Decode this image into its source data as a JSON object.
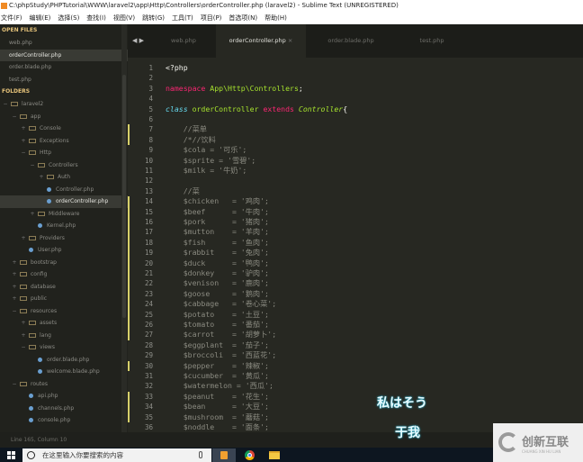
{
  "window": {
    "title": "C:\\phpStudy\\PHPTutorial\\WWW\\laravel2\\app\\Http\\Controllers\\orderController.php (laravel2) - Sublime Text (UNREGISTERED)"
  },
  "menu": [
    "文件(F)",
    "编辑(E)",
    "选择(S)",
    "查找(I)",
    "视图(V)",
    "跳转(G)",
    "工具(T)",
    "项目(P)",
    "首选项(N)",
    "帮助(H)"
  ],
  "sidebar": {
    "open_files_label": "OPEN FILES",
    "open_files": [
      "web.php",
      "orderController.php",
      "order.blade.php",
      "test.php"
    ],
    "folders_label": "FOLDERS",
    "tree": [
      {
        "label": "laravel2",
        "type": "folder",
        "depth": 0,
        "toggle": "−"
      },
      {
        "label": "app",
        "type": "folder",
        "depth": 1,
        "toggle": "−"
      },
      {
        "label": "Console",
        "type": "folder",
        "depth": 2,
        "toggle": "+"
      },
      {
        "label": "Exceptions",
        "type": "folder",
        "depth": 2,
        "toggle": "+"
      },
      {
        "label": "Http",
        "type": "folder",
        "depth": 2,
        "toggle": "−"
      },
      {
        "label": "Controllers",
        "type": "folder",
        "depth": 3,
        "toggle": "−"
      },
      {
        "label": "Auth",
        "type": "folder",
        "depth": 4,
        "toggle": "+"
      },
      {
        "label": "Controller.php",
        "type": "file",
        "depth": 5
      },
      {
        "label": "orderController.php",
        "type": "file",
        "depth": 5,
        "selected": true
      },
      {
        "label": "Middleware",
        "type": "folder",
        "depth": 3,
        "toggle": "+"
      },
      {
        "label": "Kernel.php",
        "type": "file",
        "depth": 4
      },
      {
        "label": "Providers",
        "type": "folder",
        "depth": 2,
        "toggle": "+"
      },
      {
        "label": "User.php",
        "type": "file",
        "depth": 3
      },
      {
        "label": "bootstrap",
        "type": "folder",
        "depth": 1,
        "toggle": "+"
      },
      {
        "label": "config",
        "type": "folder",
        "depth": 1,
        "toggle": "+"
      },
      {
        "label": "database",
        "type": "folder",
        "depth": 1,
        "toggle": "+"
      },
      {
        "label": "public",
        "type": "folder",
        "depth": 1,
        "toggle": "+"
      },
      {
        "label": "resources",
        "type": "folder",
        "depth": 1,
        "toggle": "−"
      },
      {
        "label": "assets",
        "type": "folder",
        "depth": 2,
        "toggle": "+"
      },
      {
        "label": "lang",
        "type": "folder",
        "depth": 2,
        "toggle": "+"
      },
      {
        "label": "views",
        "type": "folder",
        "depth": 2,
        "toggle": "−"
      },
      {
        "label": "order.blade.php",
        "type": "file",
        "depth": 4
      },
      {
        "label": "welcome.blade.php",
        "type": "file",
        "depth": 4
      },
      {
        "label": "routes",
        "type": "folder",
        "depth": 1,
        "toggle": "−"
      },
      {
        "label": "api.php",
        "type": "file",
        "depth": 3
      },
      {
        "label": "channels.php",
        "type": "file",
        "depth": 3
      },
      {
        "label": "console.php",
        "type": "file",
        "depth": 3
      }
    ]
  },
  "tabs": {
    "nav": "◀ ▶",
    "items": [
      {
        "label": "web.php"
      },
      {
        "label": "orderController.php",
        "active": true,
        "close": "×"
      },
      {
        "label": "order.blade.php"
      },
      {
        "label": "test.php"
      }
    ]
  },
  "editor": {
    "modified_lines": [
      7,
      8,
      14,
      15,
      16,
      17,
      18,
      19,
      20,
      21,
      22,
      23,
      24,
      25,
      26,
      27,
      30,
      33,
      34,
      35
    ],
    "lines": [
      [
        [
          "w",
          "<?php"
        ]
      ],
      [],
      [
        [
          "k",
          "namespace "
        ],
        [
          "g",
          "App\\Http\\Controllers"
        ],
        [
          "w",
          ";"
        ]
      ],
      [],
      [
        [
          "c",
          "class "
        ],
        [
          "g",
          "orderController "
        ],
        [
          "k",
          "extends "
        ],
        [
          "gi",
          "Controller"
        ],
        [
          "w",
          "{"
        ]
      ],
      [],
      [
        [
          "d",
          "    //菜单"
        ]
      ],
      [
        [
          "d",
          "    /*//饮料"
        ]
      ],
      [
        [
          "d",
          "    $cola = '可乐';"
        ]
      ],
      [
        [
          "d",
          "    $sprite = '雪碧';"
        ]
      ],
      [
        [
          "d",
          "    $milk = '牛奶';"
        ]
      ],
      [],
      [
        [
          "d",
          "    //菜"
        ]
      ],
      [
        [
          "d",
          "    $chicken   = '鸡肉';"
        ]
      ],
      [
        [
          "d",
          "    $beef      = '牛肉';"
        ]
      ],
      [
        [
          "d",
          "    $pork      = '猪肉';"
        ]
      ],
      [
        [
          "d",
          "    $mutton    = '羊肉';"
        ]
      ],
      [
        [
          "d",
          "    $fish      = '鱼肉';"
        ]
      ],
      [
        [
          "d",
          "    $rabbit    = '兔肉';"
        ]
      ],
      [
        [
          "d",
          "    $duck      = '鸭肉';"
        ]
      ],
      [
        [
          "d",
          "    $donkey    = '驴肉';"
        ]
      ],
      [
        [
          "d",
          "    $venison   = '鹿肉';"
        ]
      ],
      [
        [
          "d",
          "    $goose     = '鹅肉';"
        ]
      ],
      [
        [
          "d",
          "    $cabbage   = '卷心菜';"
        ]
      ],
      [
        [
          "d",
          "    $potato    = '土豆';"
        ]
      ],
      [
        [
          "d",
          "    $tomato    = '番茄';"
        ]
      ],
      [
        [
          "d",
          "    $carrot    = '胡萝卜';"
        ]
      ],
      [
        [
          "d",
          "    $eggplant  = '茄子';"
        ]
      ],
      [
        [
          "d",
          "    $broccoli  = '西蓝花';"
        ]
      ],
      [
        [
          "d",
          "    $pepper    = '辣椒';"
        ]
      ],
      [
        [
          "d",
          "    $cucumber  = '黄瓜';"
        ]
      ],
      [
        [
          "d",
          "    $watermelon = '西瓜';"
        ]
      ],
      [
        [
          "d",
          "    $peanut    = '花生';"
        ]
      ],
      [
        [
          "d",
          "    $bean      = '大豆';"
        ]
      ],
      [
        [
          "d",
          "    $mushroom  = '蘑菇';"
        ]
      ],
      [
        [
          "d",
          "    $noddle    = '面条';"
        ]
      ]
    ]
  },
  "status": {
    "text": "Line 165, Column 10"
  },
  "taskbar": {
    "search_placeholder": "在这里输入你要搜索的内容"
  },
  "subtitles": {
    "line1": "私はそう",
    "line2": "于我"
  },
  "watermark": {
    "text": "创新互联",
    "sub": "CHUANG XIN HU LIAN"
  },
  "colors": {
    "keyword": "#f92672",
    "class": "#66d9ef",
    "name": "#a6e22e",
    "gutter_mark": "#d6d06a",
    "folder_header": "#e6c37a"
  }
}
